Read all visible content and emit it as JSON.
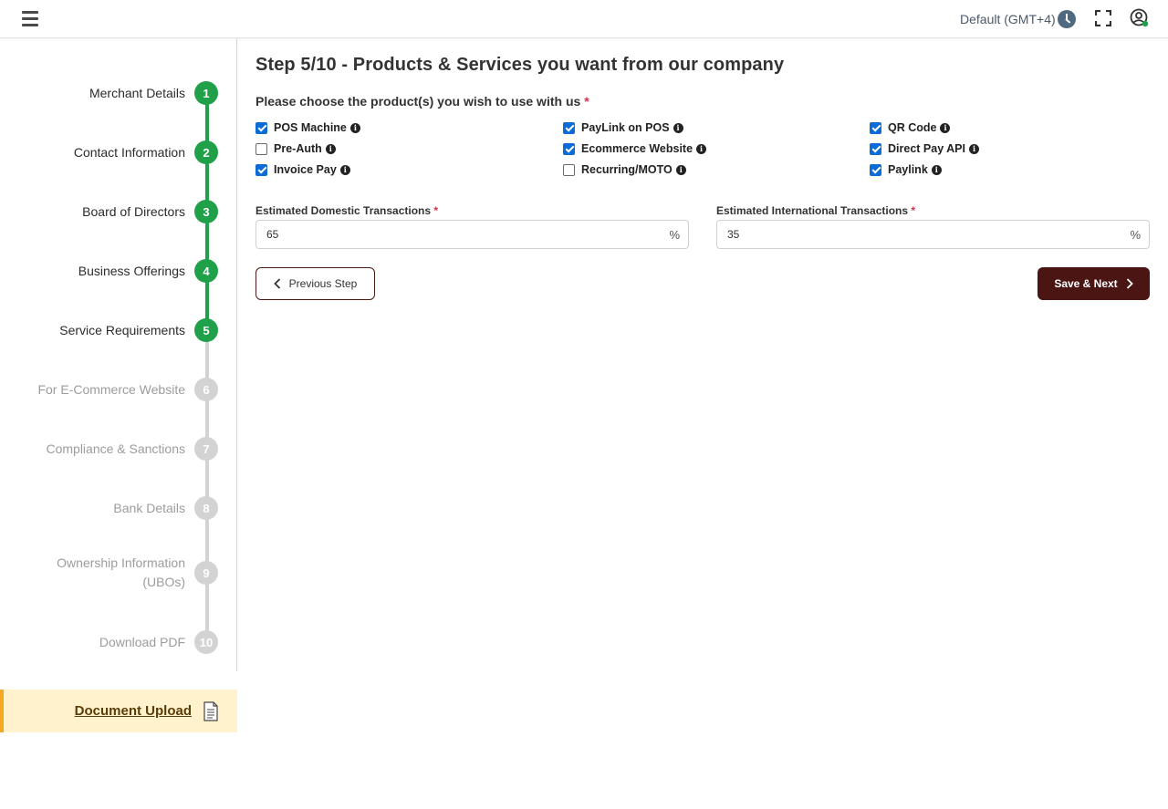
{
  "topbar": {
    "timezone": "Default (GMT+4)",
    "icons": [
      "hamburger-icon",
      "clock-icon",
      "fullscreen-icon",
      "user-icon"
    ]
  },
  "stepper": {
    "steps": [
      {
        "num": "1",
        "label": "Merchant Details",
        "status": "done"
      },
      {
        "num": "2",
        "label": "Contact Information",
        "status": "done"
      },
      {
        "num": "3",
        "label": "Board of Directors",
        "status": "done"
      },
      {
        "num": "4",
        "label": "Business Offerings",
        "status": "done"
      },
      {
        "num": "5",
        "label": "Service Requirements",
        "status": "done"
      },
      {
        "num": "6",
        "label": "For E-Commerce Website",
        "status": "todo"
      },
      {
        "num": "7",
        "label": "Compliance & Sanctions",
        "status": "todo"
      },
      {
        "num": "8",
        "label": "Bank Details",
        "status": "todo"
      },
      {
        "num": "9",
        "label_line1": "Ownership Information",
        "label_line2": "(UBOs)",
        "status": "todo"
      },
      {
        "num": "10",
        "label": "Download PDF",
        "status": "todo"
      }
    ],
    "document_upload": "Document Upload",
    "colors": {
      "done": "#21a04a",
      "todo": "#d3d3d3",
      "upload_bg": "#fff2cc",
      "upload_accent": "#f5a623"
    }
  },
  "main": {
    "title": "Step 5/10 - Products & Services you want from our company",
    "question": "Please choose the product(s) you wish to use with us",
    "required_mark": "*",
    "products": [
      {
        "label": "POS Machine",
        "checked": true
      },
      {
        "label": "PayLink on POS",
        "checked": true
      },
      {
        "label": "QR Code",
        "checked": true
      },
      {
        "label": "Pre-Auth",
        "checked": false
      },
      {
        "label": "Ecommerce Website",
        "checked": true
      },
      {
        "label": "Direct Pay API",
        "checked": true
      },
      {
        "label": "Invoice Pay",
        "checked": true
      },
      {
        "label": "Recurring/MOTO",
        "checked": false
      },
      {
        "label": "Paylink",
        "checked": true
      }
    ],
    "domestic": {
      "label": "Estimated Domestic Transactions",
      "value": "65",
      "suffix": "%"
    },
    "international": {
      "label": "Estimated International Transactions",
      "value": "35",
      "suffix": "%"
    },
    "prev_button": "Previous Step",
    "next_button": "Save & Next",
    "colors": {
      "checkbox": "#0b6cd6",
      "next_button_bg": "#4a1512",
      "required": "#d9304f"
    }
  }
}
